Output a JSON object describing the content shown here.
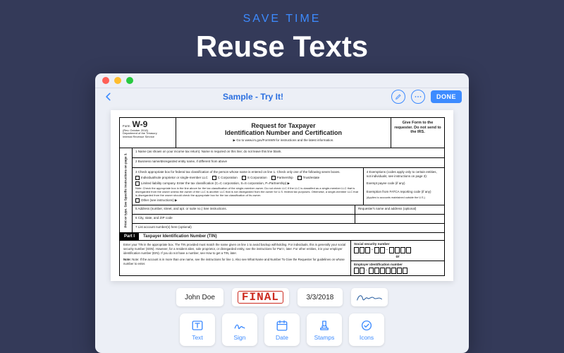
{
  "hero": {
    "subtitle": "SAVE TIME",
    "title": "Reuse Texts"
  },
  "toolbar": {
    "document_title": "Sample - Try It!",
    "done_label": "DONE"
  },
  "form": {
    "form_prefix": "Form",
    "form_number": "W-9",
    "revision": "(Rev. October 2018)",
    "dept": "Department of the Treasury",
    "irs": "Internal Revenue Service",
    "title_line1": "Request for Taxpayer",
    "title_line2": "Identification Number and Certification",
    "goto": "▶ Go to www.irs.gov/FormW9 for instructions and the latest information.",
    "right_note": "Give Form to the requester. Do not send to the IRS.",
    "sidebar": "Print or type. See Specific Instructions on page 3.",
    "row1": "1  Name (as shown on your income tax return). Name is required on this line; do not leave this line blank.",
    "row2": "2  Business name/disregarded entity name, if different from above",
    "row3_lead": "3  Check appropriate box for federal tax classification of the person whose name is entered on line 1. Check only one of the following seven boxes.",
    "checks": {
      "ind": "Individual/sole proprietor or single-member LLC",
      "ccorp": "C Corporation",
      "scorp": "S Corporation",
      "ptnr": "Partnership",
      "trust": "Trust/estate",
      "llc": "Limited liability company. Enter the tax classification (C=C corporation, S=S corporation, P=Partnership) ▶",
      "other": "Other (see instructions) ▶"
    },
    "llc_note": "Note: Check the appropriate box in the line above for the tax classification of the single-member owner. Do not check LLC if the LLC is classified as a single-member LLC that is disregarded from the owner unless the owner of the LLC is another LLC that is not disregarded from the owner for U.S. federal tax purposes. Otherwise, a single-member LLC that is disregarded from the owner should check the appropriate box for the tax classification of its owner.",
    "exempt_lead": "4  Exemptions (codes apply only to certain entities, not individuals; see instructions on page 3):",
    "exempt_payee": "Exempt payee code (if any)",
    "exempt_fatca": "Exemption from FATCA reporting code (if any)",
    "exempt_note": "(Applies to accounts maintained outside the U.S.)",
    "row5": "5  Address (number, street, and apt. or suite no.) See instructions.",
    "row5r": "Requester's name and address (optional)",
    "row6": "6  City, state, and ZIP code",
    "row7": "7  List account number(s) here (optional)",
    "part1_tag": "Part I",
    "part1_title": "Taxpayer Identification Number (TIN)",
    "part1_body": "Enter your TIN in the appropriate box. The TIN provided must match the name given on line 1 to avoid backup withholding. For individuals, this is generally your social security number (SSN). However, for a resident alien, sole proprietor, or disregarded entity, see the instructions for Part I, later. For other entities, it is your employer identification number (EIN). If you do not have a number, see How to get a TIN, later.",
    "part1_note": "Note: If the account is in more than one name, see the instructions for line 1. Also see What Name and Number To Give the Requester for guidelines on whose number to enter.",
    "ssn_label": "Social security number",
    "or": "or",
    "ein_label": "Employer identification number"
  },
  "chips": {
    "name": "John Doe",
    "final": "FINAL",
    "date": "3/3/2018"
  },
  "tools": {
    "text": "Text",
    "sign": "Sign",
    "date": "Date",
    "stamps": "Stamps",
    "icons": "Icons"
  }
}
